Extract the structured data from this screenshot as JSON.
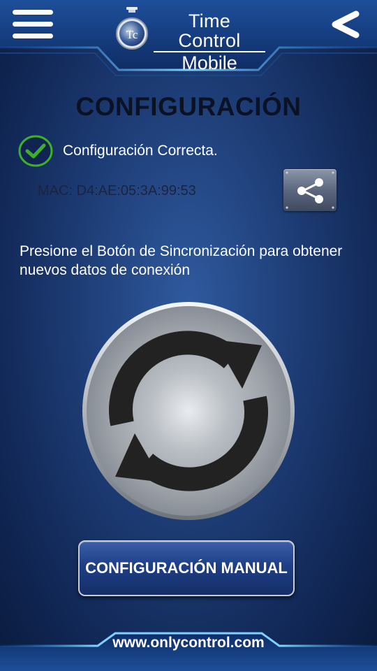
{
  "header": {
    "brand_line1": "Time Control",
    "brand_line2": "Mobile",
    "logo_text": "Tc",
    "menu_icon": "hamburger-menu-icon",
    "back_icon": "chevron-left-icon"
  },
  "main": {
    "title": "CONFIGURACIÓN",
    "status_text": "Configuración Correcta.",
    "status_icon": "check-circle-icon",
    "mac": "MAC: D4:AE:05:3A:99:53",
    "share_icon": "share-icon",
    "instructions": "Presione el Botón de Sincronización para obtener nuevos datos de conexión",
    "sync_icon": "sync-icon",
    "manual_button": "CONFIGURACIÓN MANUAL"
  },
  "footer": {
    "link": "www.onlycontrol.com"
  },
  "colors": {
    "accent": "#4fa3e0",
    "success": "#3fae2a",
    "title": "#0b1224"
  }
}
